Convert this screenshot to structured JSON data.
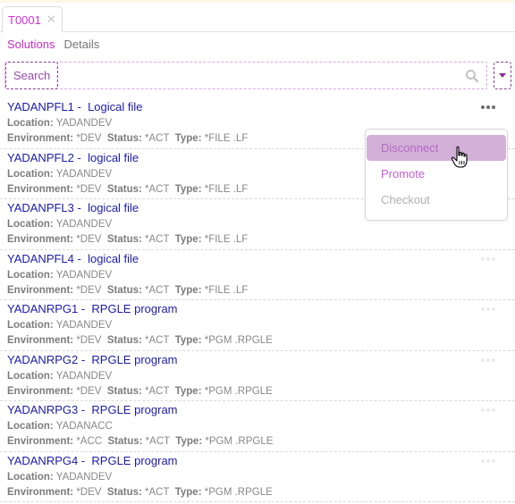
{
  "tab": {
    "label": "T0001",
    "close_icon": "close-icon"
  },
  "subtabs": [
    {
      "label": "Solutions",
      "active": true
    },
    {
      "label": "Details",
      "active": false
    }
  ],
  "search": {
    "button_label": "Search",
    "icon": "search-icon",
    "filter_icon": "caret-down-icon"
  },
  "labels": {
    "location": "Location:",
    "environment": "Environment:",
    "status": "Status:",
    "type": "Type:"
  },
  "items": [
    {
      "name": "YADANPFL1",
      "description": "Logical file",
      "location": "YADANDEV",
      "environment": "*DEV",
      "status": "*ACT",
      "type": "*FILE .LF"
    },
    {
      "name": "YADANPFL2",
      "description": "logical file",
      "location": "YADANDEV",
      "environment": "*DEV",
      "status": "*ACT",
      "type": "*FILE .LF"
    },
    {
      "name": "YADANPFL3",
      "description": "logical file",
      "location": "YADANDEV",
      "environment": "*DEV",
      "status": "*ACT",
      "type": "*FILE .LF"
    },
    {
      "name": "YADANPFL4",
      "description": "logical file",
      "location": "YADANDEV",
      "environment": "*DEV",
      "status": "*ACT",
      "type": "*FILE .LF"
    },
    {
      "name": "YADANRPG1",
      "description": "RPGLE program",
      "location": "YADANDEV",
      "environment": "*DEV",
      "status": "*ACT",
      "type": "*PGM .RPGLE"
    },
    {
      "name": "YADANRPG2",
      "description": "RPGLE program",
      "location": "YADANDEV",
      "environment": "*DEV",
      "status": "*ACT",
      "type": "*PGM .RPGLE"
    },
    {
      "name": "YADANRPG3",
      "description": "RPGLE program",
      "location": "YADANACC",
      "environment": "*ACC",
      "status": "*ACT",
      "type": "*PGM .RPGLE"
    },
    {
      "name": "YADANRPG4",
      "description": "RPGLE program",
      "location": "YADANDEV",
      "environment": "*DEV",
      "status": "*ACT",
      "type": "*PGM .RPGLE"
    }
  ],
  "context_menu": {
    "items": [
      {
        "label": "Disconnect",
        "state": "hover"
      },
      {
        "label": "Promote",
        "state": "enabled"
      },
      {
        "label": "Checkout",
        "state": "disabled"
      }
    ]
  },
  "colors": {
    "accent": "#c72fc7",
    "title_blue": "#1c1ca8",
    "menu_hover": "#d2b0d8"
  }
}
